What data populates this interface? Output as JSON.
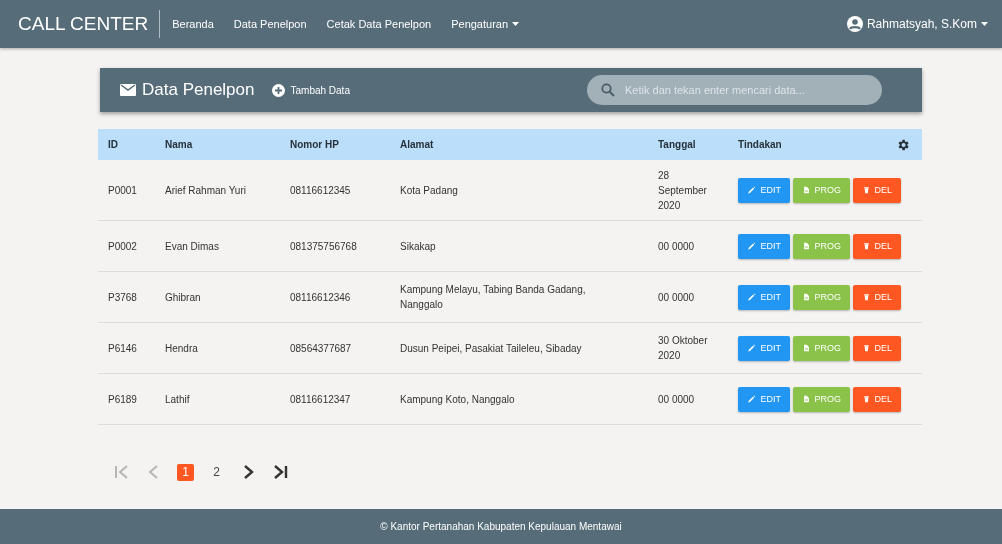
{
  "navbar": {
    "brand": "CALL CENTER",
    "links": [
      {
        "label": "Beranda",
        "dropdown": false
      },
      {
        "label": "Data Penelpon",
        "dropdown": false
      },
      {
        "label": "Cetak Data Penelpon",
        "dropdown": false
      },
      {
        "label": "Pengaturan",
        "dropdown": true
      }
    ],
    "user": "Rahmatsyah, S.Kom"
  },
  "panel": {
    "title": "Data Penelpon",
    "add_button": "Tambah Data",
    "search": {
      "placeholder": "Ketik dan tekan enter mencari data..."
    }
  },
  "table": {
    "columns": [
      "ID",
      "Nama",
      "Nomor HP",
      "Alamat",
      "Tanggal",
      "Tindakan"
    ],
    "rows": [
      {
        "cells": [
          "P0001",
          "Arief Rahman Yuri",
          "08116612345",
          "Kota Padang",
          "28 September 2020"
        ],
        "actions": [
          {
            "kind": "edit",
            "label": "EDIT"
          },
          {
            "kind": "prog",
            "label": "PROG"
          },
          {
            "kind": "del",
            "label": "DEL"
          }
        ]
      },
      {
        "cells": [
          "P0002",
          "Evan Dimas",
          "081375756768",
          "Sikakap",
          "00 0000"
        ],
        "actions": [
          {
            "kind": "edit",
            "label": "EDIT"
          },
          {
            "kind": "prog",
            "label": "PROG"
          },
          {
            "kind": "del",
            "label": "DEL"
          }
        ]
      },
      {
        "cells": [
          "P3768",
          "Ghibran",
          "08116612346",
          "Kampung Melayu, Tabing Banda Gadang, Nanggalo",
          "00 0000"
        ],
        "actions": [
          {
            "kind": "edit",
            "label": "EDIT"
          },
          {
            "kind": "prog",
            "label": "PROG"
          },
          {
            "kind": "del",
            "label": "DEL"
          }
        ]
      },
      {
        "cells": [
          "P6146",
          "Hendra",
          "08564377687",
          "Dusun Peipei, Pasakiat Taileleu, Sibaday",
          "30 Oktober 2020"
        ],
        "actions": [
          {
            "kind": "edit",
            "label": "EDIT"
          },
          {
            "kind": "prog",
            "label": "PROG"
          },
          {
            "kind": "del",
            "label": "DEL"
          }
        ]
      },
      {
        "cells": [
          "P6189",
          "Lathif",
          "08116612347",
          "Kampung Koto, Nanggalo",
          "00 0000"
        ],
        "actions": [
          {
            "kind": "edit",
            "label": "EDIT"
          },
          {
            "kind": "prog",
            "label": "PROG"
          },
          {
            "kind": "del",
            "label": "DEL"
          }
        ]
      }
    ]
  },
  "pagination": {
    "first_disabled": true,
    "prev_disabled": true,
    "next_disabled": false,
    "last_disabled": false,
    "pages": [
      {
        "label": "1",
        "selected": true
      },
      {
        "label": "2",
        "selected": false
      }
    ]
  },
  "footer": "© Kantor Pertanahan Kabupaten Kepulauan Mentawai"
}
